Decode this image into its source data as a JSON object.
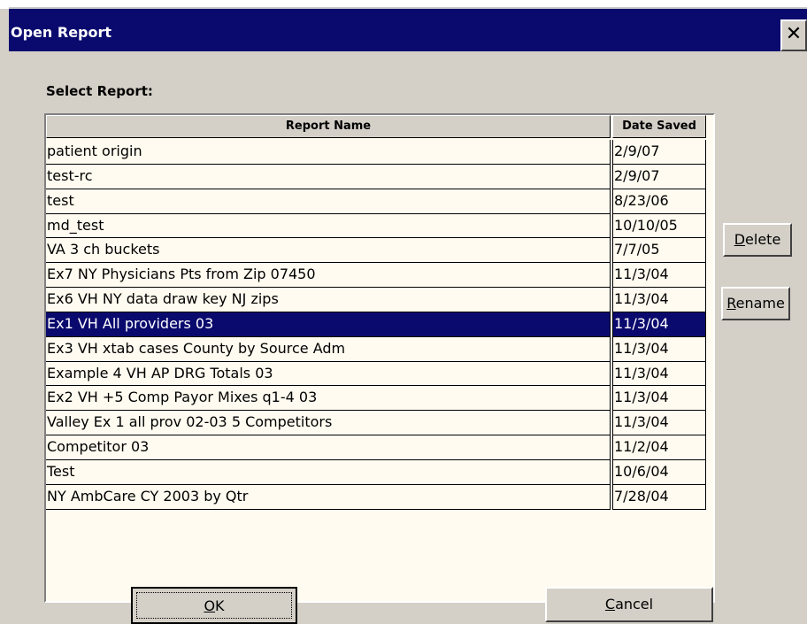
{
  "window": {
    "title": "Open Report",
    "close_glyph": "✕"
  },
  "label": "Select Report:",
  "table": {
    "columns": [
      "Report Name",
      "Date Saved"
    ],
    "rows": [
      {
        "name": "patient origin",
        "date": "2/9/07"
      },
      {
        "name": "test-rc",
        "date": "2/9/07"
      },
      {
        "name": "test",
        "date": "8/23/06"
      },
      {
        "name": "md_test",
        "date": "10/10/05"
      },
      {
        "name": "VA 3 ch buckets",
        "date": "7/7/05"
      },
      {
        "name": "Ex7 NY Physicians Pts from Zip 07450",
        "date": "11/3/04"
      },
      {
        "name": "Ex6 VH NY data  draw key NJ zips",
        "date": "11/3/04"
      },
      {
        "name": "Ex1 VH All providers 03",
        "date": "11/3/04"
      },
      {
        "name": "Ex3 VH xtab  cases County by Source Adm",
        "date": "11/3/04"
      },
      {
        "name": "Example 4 VH  AP DRG Totals 03",
        "date": "11/3/04"
      },
      {
        "name": "Ex2 VH +5 Comp Payor Mixes q1-4 03",
        "date": "11/3/04"
      },
      {
        "name": "Valley Ex 1 all prov 02-03   5 Competitors",
        "date": "11/3/04"
      },
      {
        "name": "Competitor 03",
        "date": "11/2/04"
      },
      {
        "name": "Test",
        "date": "10/6/04"
      },
      {
        "name": "NY AmbCare CY 2003 by Qtr",
        "date": "7/28/04"
      }
    ],
    "selected_index": 7
  },
  "buttons": {
    "delete": {
      "mnemonic": "D",
      "rest": "elete"
    },
    "rename": {
      "mnemonic": "R",
      "rest": "ename"
    },
    "ok": {
      "mnemonic": "O",
      "rest": "K"
    },
    "cancel": {
      "mnemonic": "C",
      "rest": "ancel"
    }
  },
  "colors": {
    "titlebar": "#0a0a6e",
    "selection": "#0a0a6e",
    "dialog_bg": "#d4d0c8",
    "list_bg": "#fffbf0"
  }
}
